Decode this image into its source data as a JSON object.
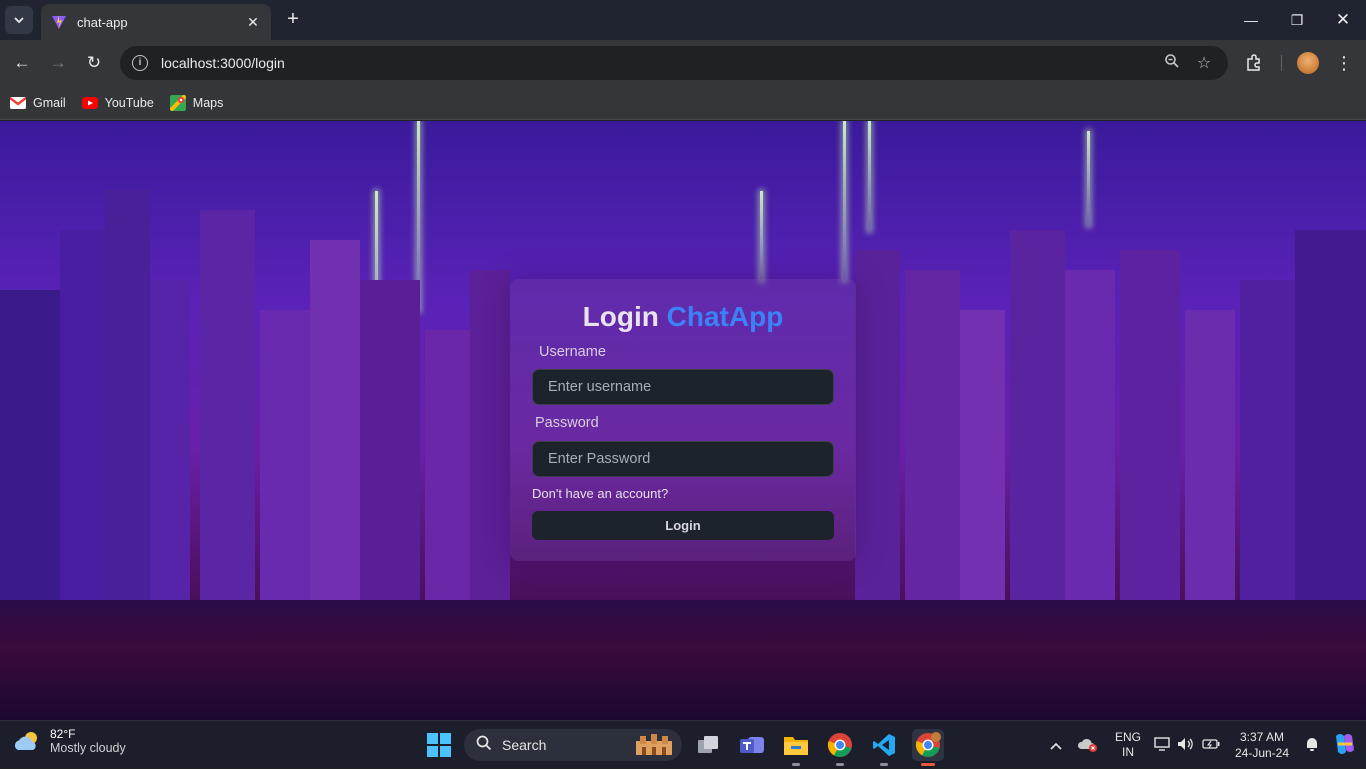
{
  "browser": {
    "tab_title": "chat-app",
    "new_tab_icon": "plus-icon",
    "url": "localhost:3000/login",
    "bookmarks": [
      {
        "label": "Gmail",
        "icon": "gmail-icon"
      },
      {
        "label": "YouTube",
        "icon": "youtube-icon"
      },
      {
        "label": "Maps",
        "icon": "maps-icon"
      }
    ]
  },
  "login": {
    "title_main": "Login",
    "title_accent": "ChatApp",
    "username_label": "Username",
    "username_placeholder": "Enter username",
    "password_label": "Password",
    "password_placeholder": "Enter Password",
    "signup_link": "Don't have an account?",
    "login_button": "Login"
  },
  "taskbar": {
    "temperature": "82°F",
    "condition": "Mostly cloudy",
    "search_label": "Search",
    "language_top": "ENG",
    "language_bottom": "IN",
    "time": "3:37 AM",
    "date": "24-Jun-24"
  },
  "colors": {
    "accent": "#3b82f6",
    "tab_bg": "#35363a",
    "taskbar_bg": "#1c1f2b"
  }
}
